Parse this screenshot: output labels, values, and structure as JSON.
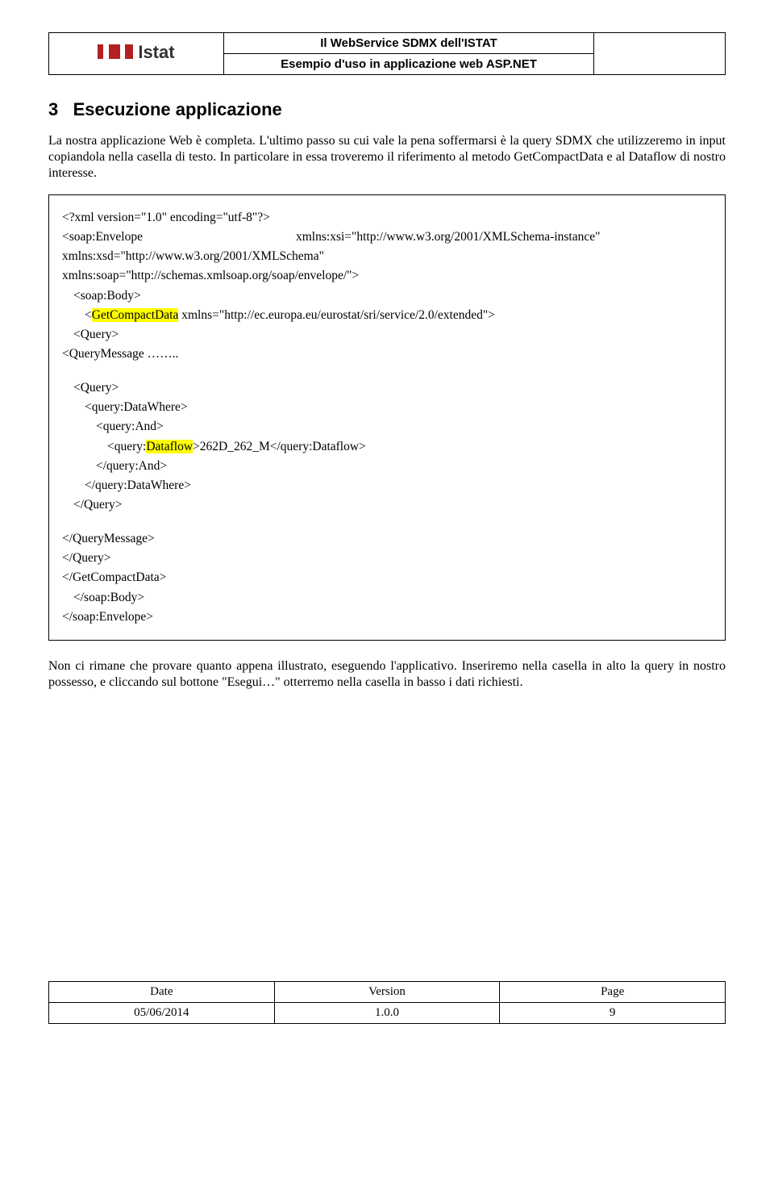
{
  "header": {
    "title_line1": "Il WebService SDMX dell'ISTAT",
    "title_line2": "Esempio d'uso in applicazione web ASP.NET",
    "logo_text": "Istat"
  },
  "section": {
    "number": "3",
    "title": "Esecuzione applicazione"
  },
  "body": {
    "p1": "La nostra applicazione Web è completa. L'ultimo passo su cui vale la pena soffermarsi è la query SDMX che utilizzeremo in input copiandola nella casella di testo. In particolare in essa troveremo il riferimento al metodo GetCompactData e al Dataflow di nostro interesse.",
    "p2": "Non ci rimane che provare quanto appena illustrato, eseguendo l'applicativo. Inseriremo nella casella in alto la query in nostro possesso, e cliccando sul bottone \"Esegui…\" otterremo nella casella in basso i dati richiesti."
  },
  "code": {
    "l1": "<?xml version=\"1.0\" encoding=\"utf-8\"?>",
    "l2a": "<soap:Envelope",
    "l2b": "xmlns:xsi=\"http://www.w3.org/2001/XMLSchema-instance\"",
    "l3": "xmlns:xsd=\"http://www.w3.org/2001/XMLSchema\"",
    "l4": "xmlns:soap=\"http://schemas.xmlsoap.org/soap/envelope/\">",
    "l5": "<soap:Body>",
    "l6a": "<",
    "l6hl": "GetCompactData",
    "l6b": " xmlns=\"http://ec.europa.eu/eurostat/sri/service/2.0/extended\">",
    "l7": "<Query>",
    "l8": "<QueryMessage ……..",
    "l9": "<Query>",
    "l10": "<query:DataWhere>",
    "l11": "<query:And>",
    "l12a": "<query:",
    "l12hl": "Dataflow",
    "l12b": ">262D_262_M</query:Dataflow>",
    "l13": "</query:And>",
    "l14": "</query:DataWhere>",
    "l15": "</Query>",
    "l16": "</QueryMessage>",
    "l17": "</Query>",
    "l18": "</GetCompactData>",
    "l19": "</soap:Body>",
    "l20": "</soap:Envelope>"
  },
  "footer": {
    "col1_label": "Date",
    "col2_label": "Version",
    "col3_label": "Page",
    "col1_value": "05/06/2014",
    "col2_value": "1.0.0",
    "col3_value": "9"
  }
}
